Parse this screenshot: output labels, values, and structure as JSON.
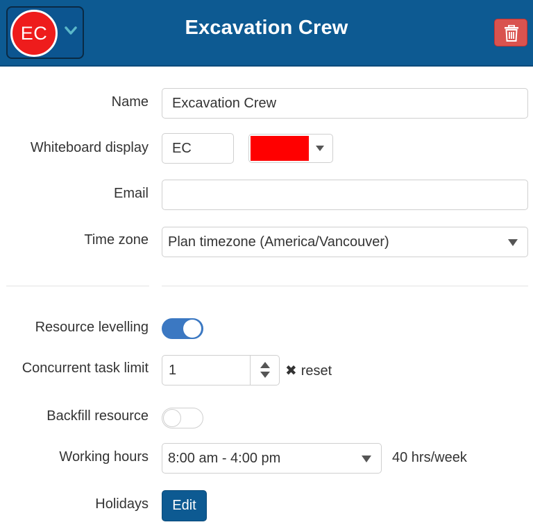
{
  "header": {
    "avatar_initials": "EC",
    "avatar_color": "#ee1c1c",
    "title": "Excavation Crew",
    "background": "#0d5a92",
    "chevron_icon": "chevron-down-icon",
    "trash_icon": "trash-icon"
  },
  "form": {
    "name": {
      "label": "Name",
      "value": "Excavation Crew"
    },
    "whiteboard": {
      "label": "Whiteboard display",
      "value": "EC",
      "color": "#ff0000"
    },
    "email": {
      "label": "Email",
      "value": ""
    },
    "timezone": {
      "label": "Time zone",
      "value": "Plan timezone (America/Vancouver)"
    },
    "resource_levelling": {
      "label": "Resource levelling",
      "enabled": true
    },
    "concurrent_limit": {
      "label": "Concurrent task limit",
      "value": "1",
      "reset_label": "reset",
      "reset_icon": "✖"
    },
    "backfill": {
      "label": "Backfill resource",
      "enabled": false
    },
    "working_hours": {
      "label": "Working hours",
      "value": "8:00 am - 4:00 pm",
      "weekly": "40 hrs/week"
    },
    "holidays": {
      "label": "Holidays",
      "button": "Edit"
    }
  }
}
